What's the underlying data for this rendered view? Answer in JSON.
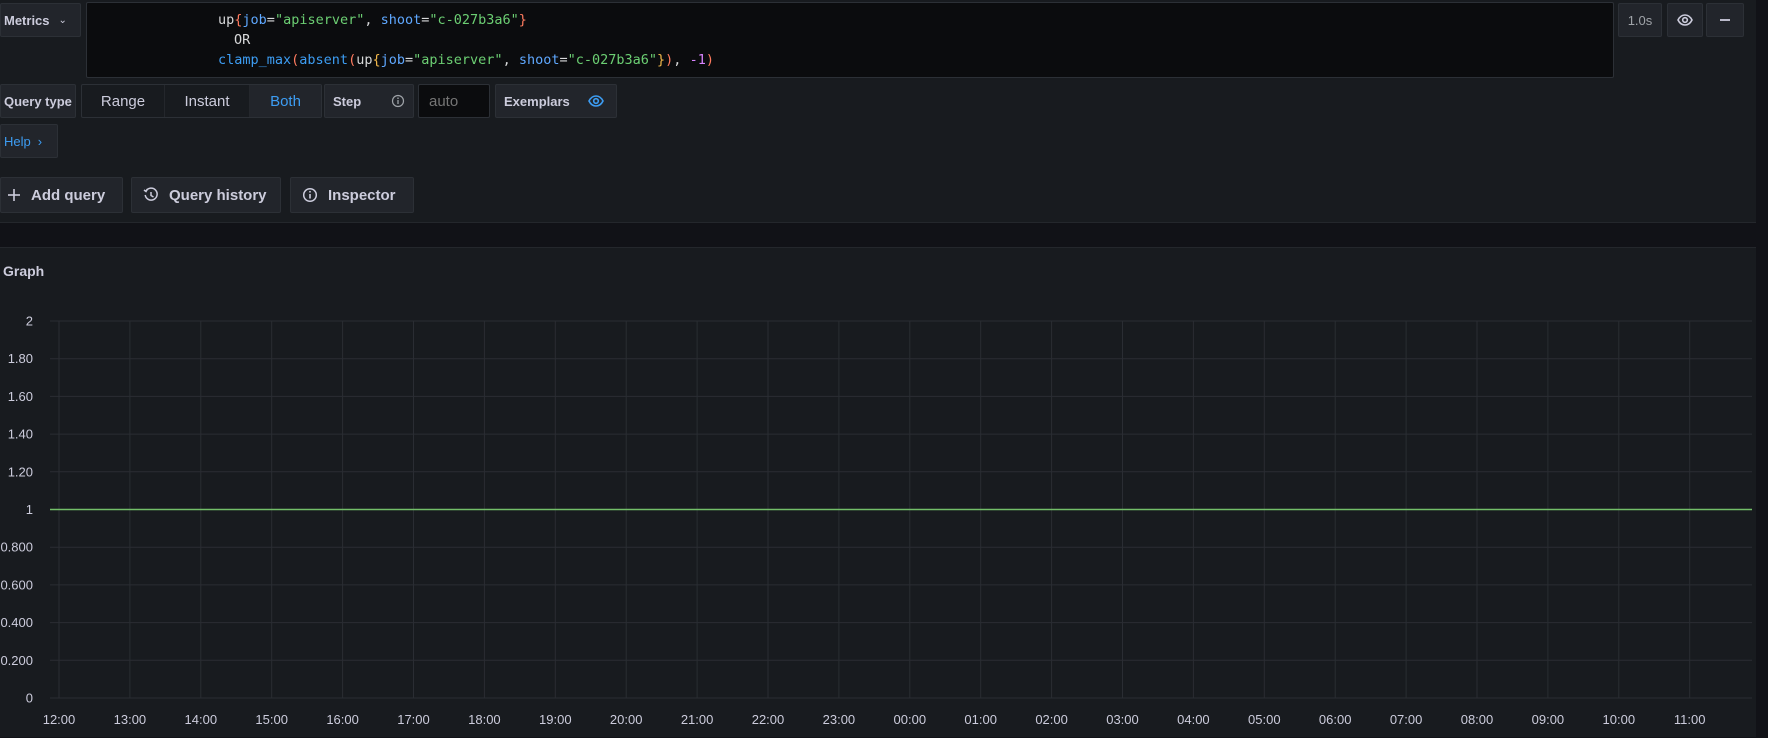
{
  "query": {
    "datasource_label": "Metrics",
    "code": {
      "line1": [
        {
          "t": "up",
          "c": "tok-fn"
        },
        {
          "t": "{",
          "c": "tok-brace2"
        },
        {
          "t": "job",
          "c": "tok-key"
        },
        {
          "t": "=",
          "c": "tok-op"
        },
        {
          "t": "\"apiserver\"",
          "c": "tok-str"
        },
        {
          "t": ", ",
          "c": "tok-op"
        },
        {
          "t": "shoot",
          "c": "tok-key"
        },
        {
          "t": "=",
          "c": "tok-op"
        },
        {
          "t": "\"c-027b3a6\"",
          "c": "tok-str"
        },
        {
          "t": "}",
          "c": "tok-brace2"
        }
      ],
      "line2": [
        {
          "t": "OR",
          "c": "tok-op"
        }
      ],
      "line3": [
        {
          "t": "clamp_max",
          "c": "tok-fn2"
        },
        {
          "t": "(",
          "c": "tok-paren"
        },
        {
          "t": "absent",
          "c": "tok-fn2"
        },
        {
          "t": "(",
          "c": "tok-paren"
        },
        {
          "t": "up",
          "c": "tok-fn"
        },
        {
          "t": "{",
          "c": "tok-brace"
        },
        {
          "t": "job",
          "c": "tok-key"
        },
        {
          "t": "=",
          "c": "tok-op"
        },
        {
          "t": "\"apiserver\"",
          "c": "tok-str"
        },
        {
          "t": ", ",
          "c": "tok-op"
        },
        {
          "t": "shoot",
          "c": "tok-key"
        },
        {
          "t": "=",
          "c": "tok-op"
        },
        {
          "t": "\"c-027b3a6\"",
          "c": "tok-str"
        },
        {
          "t": "}",
          "c": "tok-brace"
        },
        {
          "t": ")",
          "c": "tok-paren"
        },
        {
          "t": ", ",
          "c": "tok-op"
        },
        {
          "t": "-1",
          "c": "tok-num"
        },
        {
          "t": ")",
          "c": "tok-paren"
        }
      ]
    },
    "duration": "1.0s"
  },
  "options": {
    "query_type_label": "Query type",
    "query_types": [
      {
        "label": "Range",
        "active": false
      },
      {
        "label": "Instant",
        "active": false
      },
      {
        "label": "Both",
        "active": true
      }
    ],
    "step_label": "Step",
    "step_placeholder": "auto",
    "exemplars_label": "Exemplars",
    "help_label": "Help",
    "help_chevron": "›"
  },
  "actions": {
    "add_query": "Add query",
    "query_history": "Query history",
    "inspector": "Inspector"
  },
  "colors": {
    "accent": "#3d9df3",
    "series": "#73bf69"
  },
  "chart_data": {
    "type": "line",
    "title": "Graph",
    "x": [
      "12:00",
      "13:00",
      "14:00",
      "15:00",
      "16:00",
      "17:00",
      "18:00",
      "19:00",
      "20:00",
      "21:00",
      "22:00",
      "23:00",
      "00:00",
      "01:00",
      "02:00",
      "03:00",
      "04:00",
      "05:00",
      "06:00",
      "07:00",
      "08:00",
      "09:00",
      "10:00",
      "11:00"
    ],
    "y_ticks": [
      "2",
      "1.80",
      "1.60",
      "1.40",
      "1.20",
      "1",
      "0.800",
      "0.600",
      "0.400",
      "0.200",
      "0"
    ],
    "ylim": [
      0,
      2
    ],
    "series": [
      {
        "values": [
          1,
          1,
          1,
          1,
          1,
          1,
          1,
          1,
          1,
          1,
          1,
          1,
          1,
          1,
          1,
          1,
          1,
          1,
          1,
          1,
          1,
          1,
          1,
          1
        ],
        "color": "#73bf69"
      }
    ],
    "grid": true,
    "legend": "none"
  }
}
